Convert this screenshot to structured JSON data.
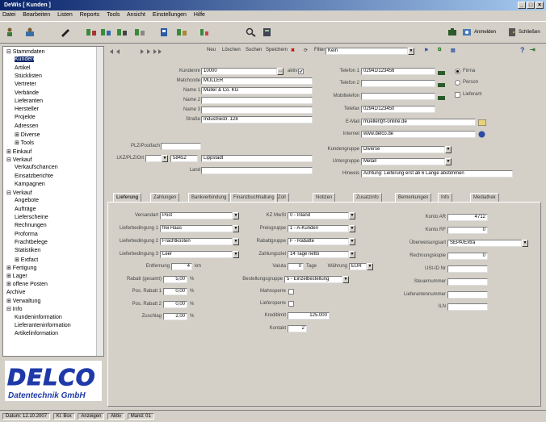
{
  "window": {
    "title": "DeWis [ Kunden ]",
    "controls": [
      "_",
      "□",
      "×"
    ]
  },
  "menu": [
    "Datei",
    "Bearbeiten",
    "Listen",
    "Reports",
    "Tools",
    "Ansicht",
    "Einstellungen",
    "Hilfe"
  ],
  "toolbar": {
    "anmelden": "Anmelden",
    "schliessen": "Schließen"
  },
  "tree": {
    "items": [
      {
        "label": "⊟ Stammdaten",
        "level": 0
      },
      {
        "label": "Kunden",
        "level": 1
      },
      {
        "label": "Artikel",
        "level": 1
      },
      {
        "label": "Stücklisten",
        "level": 1
      },
      {
        "label": "Vertreter",
        "level": 1
      },
      {
        "label": "Verbände",
        "level": 1
      },
      {
        "label": "Lieferanten",
        "level": 1
      },
      {
        "label": "Hersteller",
        "level": 1
      },
      {
        "label": "Projekte",
        "level": 1
      },
      {
        "label": "Adressen",
        "level": 1
      },
      {
        "label": "⊞ Diverse",
        "level": 1
      },
      {
        "label": "⊞ Tools",
        "level": 1
      },
      {
        "label": "⊞ Einkauf",
        "level": 0
      },
      {
        "label": "⊟ Verkauf",
        "level": 0
      },
      {
        "label": "Verkaufschancen",
        "level": 1
      },
      {
        "label": "Einsatzberichte",
        "level": 1
      },
      {
        "label": "Kampagnen",
        "level": 1
      },
      {
        "label": "⊟ Verkauf",
        "level": 0
      },
      {
        "label": "Angebote",
        "level": 1
      },
      {
        "label": "Aufträge",
        "level": 1
      },
      {
        "label": "Lieferscheine",
        "level": 1
      },
      {
        "label": "Rechnungen",
        "level": 1
      },
      {
        "label": "Proforma",
        "level": 1
      },
      {
        "label": "Frachtbelege",
        "level": 1
      },
      {
        "label": "Statistiken",
        "level": 1
      },
      {
        "label": "⊞ Extfact",
        "level": 1
      },
      {
        "label": "⊞ Fertigung",
        "level": 0
      },
      {
        "label": "⊞ Lager",
        "level": 0
      },
      {
        "label": "⊞ offene Posten",
        "level": 0
      },
      {
        "label": "Archive",
        "level": 0
      },
      {
        "label": "⊞ Verwaltung",
        "level": 0
      },
      {
        "label": "⊟ Info",
        "level": 0
      },
      {
        "label": "Kundeninformation",
        "level": 1
      },
      {
        "label": "Lieferanteninformation",
        "level": 1
      },
      {
        "label": "Artikelinformation",
        "level": 1
      }
    ]
  },
  "logo": {
    "wordmark": "DELCO",
    "sub": "Datentechnik GmbH"
  },
  "nav": {
    "neu": "Neu",
    "loeschen": "Löschen",
    "suchen": "Suchen",
    "speichern": "Speichern",
    "filter_label": "Filter",
    "filter_value": "Kein"
  },
  "form": {
    "kundennr_label": "Kundennr",
    "kundennr": "10000",
    "aktiv_label": "aktiv",
    "matchcode_label": "Matchcode",
    "matchcode": "MÜLLER",
    "name1_label": "Name 1",
    "name1": "Müller & Co. KG",
    "name2_label": "Name 2",
    "name2": "",
    "name3_label": "Name 3",
    "name3": "",
    "strasse_label": "Straße",
    "strasse": "Industriestr. 128",
    "plz_label": "PLZ/Postfach",
    "plz": "",
    "lkz_label": "LKZ/PLZ/Ort",
    "lkz": "",
    "plzort": "58452",
    "ort": "Lippstadt",
    "land_label": "Land",
    "land": "",
    "telefon1_label": "Telefon 1",
    "telefon1": "02941/123456",
    "telefon2_label": "Telefon 2",
    "telefon2": "",
    "mobil_label": "Mobiltelefon",
    "mobil": "",
    "telefax_label": "Telefax",
    "telefax": "02941/123450",
    "email_label": "E-Mail",
    "email": "mueller@t-online.de",
    "internet_label": "Internet",
    "internet": "www.delco.de",
    "radio_firma": "Firma",
    "radio_person": "Person",
    "chk_lieferant": "Lieferant",
    "kundengruppe_label": "Kundengruppe",
    "kundengruppe": "Diverse",
    "untergruppe_label": "Untergruppe",
    "untergruppe": "Metall",
    "hinweis_label": "Hinweis",
    "hinweis": "Achtung: Lieferung erst ab 6 Lange abstimmen"
  },
  "tabs": [
    "Lieferung",
    "Zahlungen",
    "Bankverbindung",
    "Finanzbuchhaltung",
    "Zoll",
    "Notizen",
    "Zusatzinfo",
    "Bemerkungen",
    "Info",
    "Mediathek"
  ],
  "delivery": {
    "versandart_label": "Versandart",
    "versandart": "Post",
    "lb1_label": "Lieferbedingung 1",
    "lb1": "frei Haus",
    "lb2_label": "Lieferbedingung 2",
    "lb2": "Frachtkosten",
    "lb3_label": "Lieferbedingung 3",
    "lb3": "Leer",
    "entfernung_label": "Entfernung",
    "entfernung": "4",
    "entfernung_unit": "km",
    "rabatt_label": "Rabatt (gesamt)",
    "rabatt": "5,00",
    "pos_rabatt1_label": "Pos. Rabatt 1",
    "pos_rabatt1": "0,00",
    "pos_rabatt2_label": "Pos. Rabatt 2",
    "pos_rabatt2": "0,00",
    "zuschlag_label": "Zuschlag",
    "zuschlag": "2,00",
    "pct": "%"
  },
  "middle": {
    "kzmwst_label": "KZ MwSt",
    "kzmwst": "0 - Inland",
    "preisgruppe_label": "Preisgruppe",
    "preisgruppe": "1 - A-Kunden",
    "rabattgruppe_label": "Rabattgruppe",
    "rabattgruppe": "F - Rabatte",
    "zahlungsziel_label": "Zahlungsziel",
    "zahlungsziel": "14 Tage netto",
    "valuta_label": "Valuta",
    "valuta": "0",
    "tage": "Tage",
    "waehrung_label": "Währung",
    "waehrung": "EUR",
    "bestellgruppe_label": "Bestellungsgruppe",
    "bestellgruppe": "5 - Einzelbestellung",
    "mahnsperre_label": "Mahnsperre",
    "liefersperre_label": "Liefersperre",
    "kreditlimit_label": "Kreditlimit",
    "kreditlimit": "125.000",
    "kontakt_label": "Kontakt",
    "kontakt": "2"
  },
  "right": {
    "konto_label": "Konto AR",
    "konto": "4712",
    "konto_rf_label": "Konto RF",
    "konto_rf": "0",
    "ueberw_label": "Überweisungsart",
    "ueberw": "SEPA/Extra",
    "rechnung_label": "Rechnungskopie",
    "rechnung": "0",
    "ustid_label": "USt-ID Nr",
    "ustid": "",
    "steuernr_label": "Steuernummer",
    "steuernr": "",
    "lieferant_label": "Lieferantennummer",
    "lieferant": "",
    "ili_label": "ILN",
    "ili": ""
  },
  "status": [
    "Datum: 12.10.2007",
    "Kl. Box",
    "Anzeigen",
    "Aktiv",
    "Mand: 01"
  ]
}
